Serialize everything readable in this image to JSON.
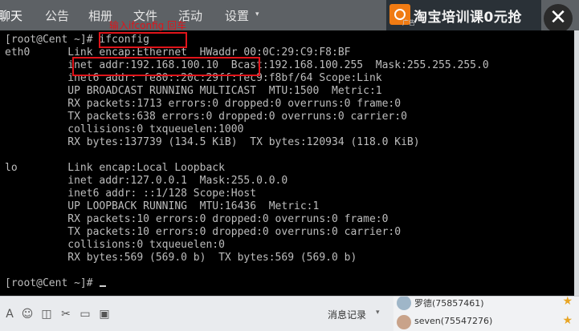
{
  "tabs": [
    "聊天",
    "公告",
    "相册",
    "文件",
    "活动",
    "设置"
  ],
  "tab_dropdown_caret": "▾",
  "ad": {
    "tag": "广告",
    "text": "淘宝培训课0元抢"
  },
  "close_icon": "✕",
  "annotation": "输入ifconfig 回车",
  "terminal_lines": [
    "[root@Cent ~]# ifconfig",
    "eth0      Link encap:Ethernet  HWaddr 00:0C:29:C9:F8:BF",
    "          inet addr:192.168.100.10  Bcast:192.168.100.255  Mask:255.255.255.0",
    "          inet6 addr: fe80::20c:29ff:fec9:f8bf/64 Scope:Link",
    "          UP BROADCAST RUNNING MULTICAST  MTU:1500  Metric:1",
    "          RX packets:1713 errors:0 dropped:0 overruns:0 frame:0",
    "          TX packets:638 errors:0 dropped:0 overruns:0 carrier:0",
    "          collisions:0 txqueuelen:1000",
    "          RX bytes:137739 (134.5 KiB)  TX bytes:120934 (118.0 KiB)",
    "",
    "lo        Link encap:Local Loopback",
    "          inet addr:127.0.0.1  Mask:255.0.0.0",
    "          inet6 addr: ::1/128 Scope:Host",
    "          UP LOOPBACK RUNNING  MTU:16436  Metric:1",
    "          RX packets:10 errors:0 dropped:0 overruns:0 frame:0",
    "          TX packets:10 errors:0 dropped:0 overruns:0 carrier:0",
    "          collisions:0 txqueuelen:0",
    "          RX bytes:569 (569.0 b)  TX bytes:569 (569.0 b)",
    "",
    "[root@Cent ~]# "
  ],
  "bottom": {
    "message_record": "消息记录",
    "caret": "▾"
  },
  "members": [
    {
      "name": "罗德(75857461)"
    },
    {
      "name": "seven(75547276)"
    }
  ],
  "colors": {
    "highlight": "#e0141a",
    "terminal_bg": "#000000",
    "terminal_fg": "#bdbdbd"
  }
}
